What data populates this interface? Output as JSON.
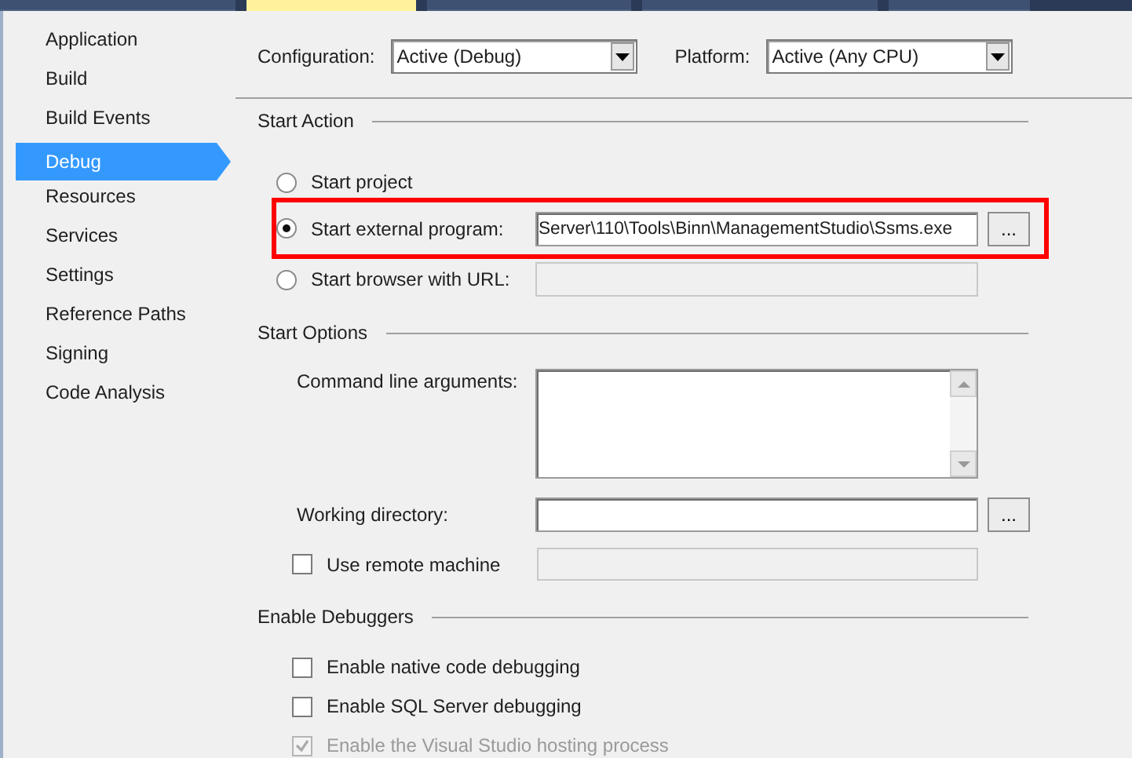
{
  "tabs": [
    {
      "selected": false
    },
    {
      "selected": true
    },
    {
      "selected": false
    },
    {
      "selected": false
    },
    {
      "selected": false
    }
  ],
  "sidebar": {
    "items": [
      {
        "label": "Application",
        "selected": false
      },
      {
        "label": "Build",
        "selected": false
      },
      {
        "label": "Build Events",
        "selected": false
      },
      {
        "label": "Debug",
        "selected": true
      },
      {
        "label": "Resources",
        "selected": false
      },
      {
        "label": "Services",
        "selected": false
      },
      {
        "label": "Settings",
        "selected": false
      },
      {
        "label": "Reference Paths",
        "selected": false
      },
      {
        "label": "Signing",
        "selected": false
      },
      {
        "label": "Code Analysis",
        "selected": false
      }
    ]
  },
  "configuration": {
    "label": "Configuration:",
    "value": "Active (Debug)"
  },
  "platform": {
    "label": "Platform:",
    "value": "Active (Any CPU)"
  },
  "start_action": {
    "title": "Start Action",
    "options": [
      {
        "kind": "plain",
        "label": "Start project",
        "selected": false,
        "highlighted": false
      },
      {
        "kind": "browse",
        "label": "Start external program:",
        "selected": true,
        "highlighted": true,
        "value": "Server\\110\\Tools\\Binn\\ManagementStudio\\Ssms.exe",
        "button": "..."
      },
      {
        "kind": "field",
        "label": "Start browser with URL:",
        "selected": false,
        "highlighted": false,
        "disabled": true
      }
    ]
  },
  "start_options": {
    "title": "Start Options",
    "command_line_arguments": {
      "label": "Command line arguments:"
    },
    "working_directory": {
      "label": "Working directory:",
      "button": "..."
    },
    "remote_machine": {
      "label": "Use remote machine",
      "checked": false,
      "field_disabled": true
    }
  },
  "enable_debuggers": {
    "title": "Enable Debuggers",
    "items": [
      {
        "label": "Enable native code debugging",
        "checked": false,
        "disabled": false
      },
      {
        "label": "Enable SQL Server debugging",
        "checked": false,
        "disabled": false
      },
      {
        "label": "Enable the Visual Studio hosting process",
        "checked": true,
        "disabled": true
      }
    ]
  }
}
